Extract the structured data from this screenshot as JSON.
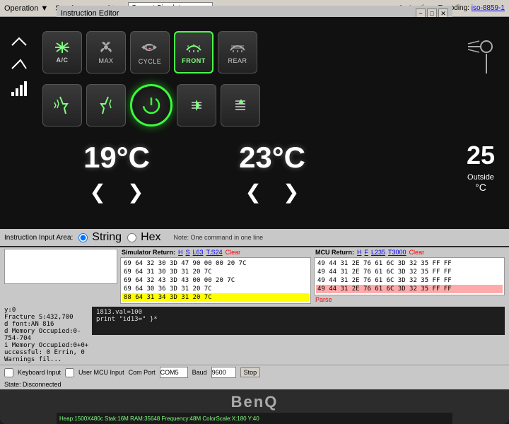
{
  "window": {
    "title": "Instruction Editor",
    "minimize": "−",
    "maximize": "□",
    "close": "✕"
  },
  "toolbar": {
    "operation_label": "Operation ▼",
    "send_label": "Send command to:",
    "send_target": "Current Simulator",
    "encoding_label": "Instructions Encoding:",
    "encoding_value": "iso-8859-1"
  },
  "hvac": {
    "buttons_top": [
      {
        "id": "ac",
        "label": "A/C",
        "icon": "❄",
        "active": false
      },
      {
        "id": "max",
        "label": "MAX",
        "icon": "✿",
        "active": false
      },
      {
        "id": "cycle",
        "label": "CYCLE",
        "icon": "⟳",
        "active": false
      },
      {
        "id": "front",
        "label": "FRONT",
        "icon": "≋",
        "active": true
      },
      {
        "id": "rear",
        "label": "REAR",
        "icon": "⋮",
        "active": false
      }
    ],
    "buttons_bottom": [
      {
        "id": "seat1",
        "label": "",
        "icon": "🪑",
        "active": false
      },
      {
        "id": "seat2",
        "label": "",
        "icon": "🪑",
        "active": false
      },
      {
        "id": "power",
        "label": "",
        "icon": "⏻",
        "active": true
      },
      {
        "id": "airflow1",
        "label": "",
        "icon": "⊹",
        "active": false
      },
      {
        "id": "airflow2",
        "label": "",
        "icon": "⊹",
        "active": false
      }
    ],
    "temp_left": "19°C",
    "temp_right": "23°C",
    "temp_outside": "25",
    "outside_label": "Outside",
    "outside_unit": "°C"
  },
  "simulator_return": {
    "label": "Simulator Return:",
    "h_label": "H",
    "s_label": "S",
    "l63_label": "L63",
    "t524_label": "T.S24",
    "clear_label": "Clear",
    "lines": [
      "69 64 32 30 3D 47 90 00 00 20 7C",
      "69 64 31 30 3D 31 20 7C",
      "69 64 32 43 3D 43 00 00 20 7C",
      "69 64 30 36 3D 31 20 7C",
      "88 64 31 34 3D 31 20 7C"
    ],
    "highlighted_line": 4
  },
  "mcu_return": {
    "label": "MCU Return:",
    "h_label": "H",
    "f_label": "F",
    "l235_label": "L235",
    "t3000_label": "T3000",
    "clear_label": "Clear",
    "lines": [
      "49 44 31 2E 76 61 6C 3D 32 35 FF FF",
      "49 44 31 2E 76 61 6C 3D 32 35 FF FF",
      "49 44 31 2E 76 61 6C 3D 32 35 FF FF",
      "49 44 31 2E 76 61 6C 3D 32 35 FF FF"
    ],
    "highlighted_line": 3,
    "parse_label": "Parse"
  },
  "instruction_input": {
    "label": "Instruction Input Area:",
    "string_label": "String",
    "hex_label": "Hex",
    "note": "Note: One command in one line"
  },
  "bottom_bar": {
    "keyboard_label": "Keyboard Input",
    "user_mcu_label": "User MCU Input",
    "com_port_label": "Com Port",
    "com_port_value": "COM5",
    "baud_label": "Baud",
    "baud_value": "9600",
    "stop_label": "Stop"
  },
  "status": {
    "state": "State: Disconnected",
    "lines": [
      "y:0",
      "Fracture S:432,700",
      "d font:AN 816",
      "d Memory Occupied:0-754-704",
      "i Memory Occupied:0+0+",
      "uccessful: 0 Errin, 0 Warnings fil..."
    ]
  },
  "script": {
    "lines": [
      "1813.val=100",
      "print \"id13=\" }*"
    ]
  },
  "benq": {
    "logo": "BenQ"
  },
  "statusbar": {
    "text": "Heap:1500X480c Stak:16M RAM:35648 Frequency:48M  ColorScale:X:180 Y:40"
  }
}
